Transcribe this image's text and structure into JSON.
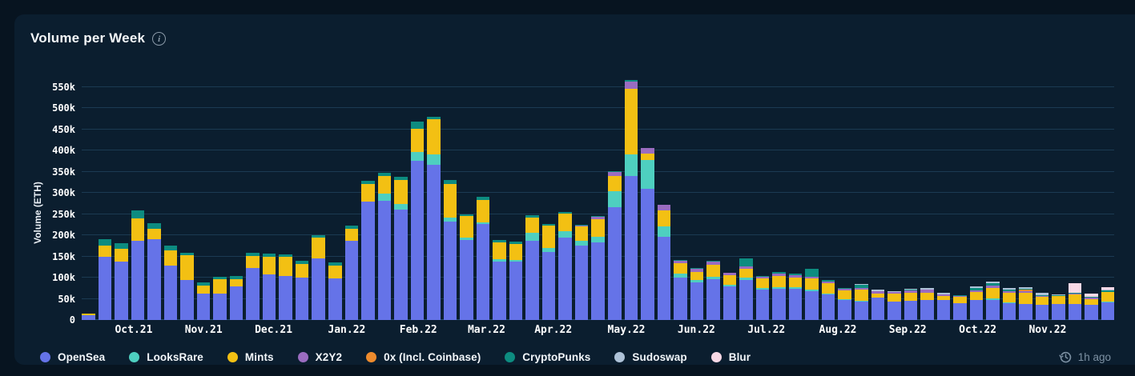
{
  "header": {
    "title": "Volume per Week"
  },
  "updated": {
    "label": "1h ago"
  },
  "colors": {
    "page_bg": "#071420",
    "card_bg": "#0b1e2f",
    "grid_line": "#1b3a52",
    "axis_line": "#27506e",
    "text": "#f2f6fa",
    "muted_text": "#7d91a3"
  },
  "chart_data": {
    "type": "bar",
    "stacked": true,
    "title": "Volume per Week",
    "xlabel": "",
    "ylabel": "Volume (ETH)",
    "unit": "thousand ETH (k)",
    "grid": true,
    "legend_position": "bottom",
    "ylim_k": [
      0,
      550
    ],
    "y_tick_step_k": 50,
    "y_ticks": [
      "0",
      "50k",
      "100k",
      "150k",
      "200k",
      "250k",
      "300k",
      "350k",
      "400k",
      "450k",
      "500k",
      "550k"
    ],
    "x_month_ticks": [
      {
        "label": "Oct.21",
        "pos_pct": 5.08
      },
      {
        "label": "Nov.21",
        "pos_pct": 11.9
      },
      {
        "label": "Dec.21",
        "pos_pct": 18.73
      },
      {
        "label": "Jan.22",
        "pos_pct": 25.87
      },
      {
        "label": "Feb.22",
        "pos_pct": 32.86
      },
      {
        "label": "Mar.22",
        "pos_pct": 39.52
      },
      {
        "label": "Apr.22",
        "pos_pct": 46.03
      },
      {
        "label": "May.22",
        "pos_pct": 53.17
      },
      {
        "label": "Jun.22",
        "pos_pct": 60.0
      },
      {
        "label": "Jul.22",
        "pos_pct": 66.83
      },
      {
        "label": "Aug.22",
        "pos_pct": 73.81
      },
      {
        "label": "Sep.22",
        "pos_pct": 80.63
      },
      {
        "label": "Oct.22",
        "pos_pct": 87.46
      },
      {
        "label": "Nov.22",
        "pos_pct": 94.29
      }
    ],
    "series": [
      {
        "name": "OpenSea",
        "color": "#6573e8"
      },
      {
        "name": "LooksRare",
        "color": "#4ecfc0"
      },
      {
        "name": "Mints",
        "color": "#f3c013"
      },
      {
        "name": "X2Y2",
        "color": "#9a6cc0"
      },
      {
        "name": "0x (Incl. Coinbase)",
        "color": "#ee8b2d"
      },
      {
        "name": "CryptoPunks",
        "color": "#0d8c80"
      },
      {
        "name": "Sudoswap",
        "color": "#aec2d8"
      },
      {
        "name": "Blur",
        "color": "#f9d9e6"
      }
    ],
    "weeks_values_k": [
      [
        11,
        0,
        5,
        0,
        0,
        0,
        0,
        0
      ],
      [
        150,
        0,
        26,
        0,
        0,
        14,
        0,
        0
      ],
      [
        138,
        0,
        30,
        0,
        0,
        13,
        0,
        0
      ],
      [
        186,
        0,
        54,
        0,
        0,
        18,
        0,
        0
      ],
      [
        190,
        0,
        25,
        0,
        0,
        13,
        0,
        0
      ],
      [
        129,
        0,
        36,
        0,
        0,
        10,
        0,
        0
      ],
      [
        95,
        0,
        58,
        0,
        0,
        6,
        0,
        0
      ],
      [
        62,
        0,
        20,
        0,
        0,
        6,
        0,
        0
      ],
      [
        62,
        0,
        34,
        0,
        0,
        6,
        0,
        0
      ],
      [
        79,
        0,
        17,
        0,
        0,
        8,
        0,
        0
      ],
      [
        123,
        0,
        28,
        0,
        0,
        8,
        0,
        0
      ],
      [
        107,
        0,
        43,
        0,
        0,
        6,
        0,
        0
      ],
      [
        104,
        0,
        45,
        0,
        0,
        6,
        0,
        0
      ],
      [
        100,
        0,
        33,
        0,
        0,
        7,
        0,
        0
      ],
      [
        145,
        0,
        50,
        0,
        0,
        5,
        0,
        0
      ],
      [
        98,
        0,
        31,
        0,
        0,
        7,
        0,
        0
      ],
      [
        186,
        0,
        30,
        0,
        0,
        7,
        0,
        0
      ],
      [
        280,
        0,
        41,
        0,
        0,
        8,
        0,
        0
      ],
      [
        281,
        17,
        42,
        0,
        0,
        7,
        0,
        0
      ],
      [
        260,
        14,
        57,
        0,
        0,
        6,
        0,
        0
      ],
      [
        375,
        22,
        54,
        0,
        0,
        17,
        0,
        0
      ],
      [
        367,
        23,
        84,
        0,
        0,
        5,
        0,
        0
      ],
      [
        233,
        8,
        79,
        0,
        0,
        11,
        0,
        0
      ],
      [
        188,
        6,
        52,
        0,
        0,
        3,
        0,
        0
      ],
      [
        226,
        4,
        54,
        0,
        0,
        6,
        0,
        0
      ],
      [
        138,
        5,
        40,
        0,
        0,
        6,
        0,
        0
      ],
      [
        137,
        5,
        37,
        0,
        0,
        6,
        0,
        0
      ],
      [
        187,
        18,
        37,
        0,
        0,
        6,
        0,
        0
      ],
      [
        161,
        9,
        52,
        0,
        0,
        5,
        0,
        0
      ],
      [
        195,
        15,
        40,
        0,
        0,
        4,
        0,
        0
      ],
      [
        176,
        11,
        33,
        3,
        0,
        2,
        0,
        0
      ],
      [
        183,
        13,
        42,
        5,
        0,
        3,
        0,
        0
      ],
      [
        266,
        37,
        37,
        9,
        0,
        2,
        0,
        0
      ],
      [
        340,
        50,
        156,
        16,
        0,
        4,
        0,
        0
      ],
      [
        309,
        68,
        15,
        13,
        0,
        0,
        0,
        0
      ],
      [
        196,
        25,
        38,
        12,
        0,
        0,
        0,
        0
      ],
      [
        100,
        9,
        25,
        6,
        0,
        2,
        0,
        0
      ],
      [
        88,
        6,
        20,
        6,
        0,
        2,
        0,
        0
      ],
      [
        96,
        6,
        29,
        6,
        0,
        2,
        0,
        0
      ],
      [
        79,
        4,
        23,
        6,
        0,
        0,
        0,
        0
      ],
      [
        95,
        5,
        21,
        6,
        0,
        18,
        0,
        0
      ],
      [
        71,
        5,
        22,
        4,
        0,
        2,
        0,
        0
      ],
      [
        73,
        4,
        27,
        6,
        0,
        4,
        0,
        0
      ],
      [
        74,
        4,
        23,
        5,
        0,
        4,
        0,
        0
      ],
      [
        68,
        4,
        27,
        3,
        0,
        19,
        0,
        0
      ],
      [
        60,
        2,
        25,
        4,
        0,
        4,
        0,
        0
      ],
      [
        47,
        2,
        21,
        3,
        0,
        2,
        0,
        0
      ],
      [
        44,
        2,
        25,
        5,
        0,
        6,
        2,
        0
      ],
      [
        52,
        0,
        10,
        5,
        0,
        1,
        3,
        0
      ],
      [
        43,
        1,
        18,
        4,
        0,
        0,
        3,
        0
      ],
      [
        45,
        1,
        19,
        5,
        0,
        1,
        3,
        0
      ],
      [
        47,
        0,
        18,
        6,
        0,
        1,
        4,
        0
      ],
      [
        47,
        0,
        10,
        3,
        0,
        1,
        3,
        0
      ],
      [
        40,
        0,
        14,
        2,
        0,
        2,
        1,
        0
      ],
      [
        47,
        1,
        19,
        3,
        0,
        6,
        4,
        0
      ],
      [
        48,
        3,
        25,
        5,
        0,
        5,
        5,
        0
      ],
      [
        40,
        1,
        24,
        4,
        0,
        3,
        3,
        0
      ],
      [
        38,
        0,
        27,
        4,
        2,
        3,
        3,
        0
      ],
      [
        35,
        0,
        19,
        3,
        0,
        1,
        6,
        0
      ],
      [
        37,
        0,
        19,
        1,
        0,
        2,
        1,
        0
      ],
      [
        38,
        0,
        23,
        1,
        0,
        2,
        1,
        22
      ],
      [
        35,
        0,
        14,
        3,
        0,
        2,
        1,
        7
      ],
      [
        41,
        2,
        23,
        1,
        0,
        3,
        1,
        6
      ]
    ]
  }
}
